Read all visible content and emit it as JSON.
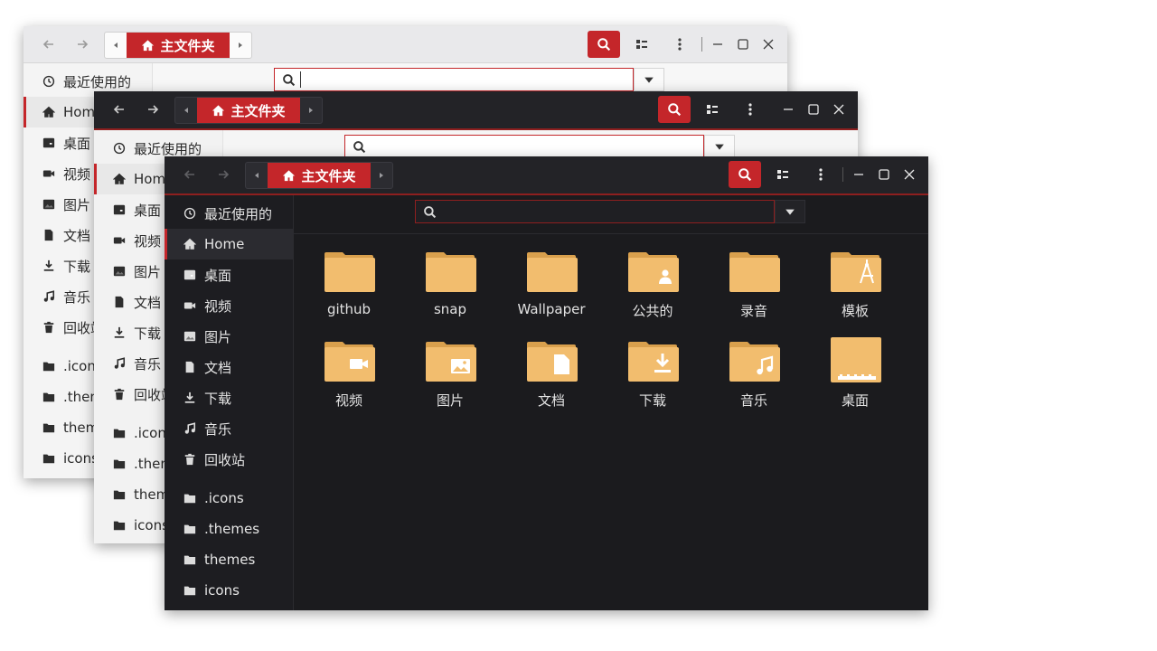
{
  "path": {
    "crumb": "主文件夹"
  },
  "sidebar_light": [
    {
      "label": "最近使用的",
      "icon": "clock-icon"
    },
    {
      "label": "Home",
      "icon": "home-icon",
      "active": true
    },
    {
      "label": "桌面",
      "icon": "desktop-icon"
    },
    {
      "label": "视频",
      "icon": "video-icon"
    },
    {
      "label": "图片",
      "icon": "image-icon"
    },
    {
      "label": "文档",
      "icon": "document-icon"
    },
    {
      "label": "下载",
      "icon": "download-icon"
    },
    {
      "label": "音乐",
      "icon": "music-icon"
    },
    {
      "label": "回收站",
      "icon": "trash-icon"
    },
    {
      "label": ".icons",
      "icon": "folder-icon"
    },
    {
      "label": ".themes",
      "icon": "folder-icon"
    },
    {
      "label": "themes",
      "icon": "folder-icon"
    },
    {
      "label": "icons",
      "icon": "folder-icon"
    }
  ],
  "sidebar_dark": [
    {
      "label": "最近使用的",
      "icon": "clock-icon"
    },
    {
      "label": "Home",
      "icon": "home-icon",
      "active": true
    },
    {
      "label": "桌面",
      "icon": "desktop-icon"
    },
    {
      "label": "视频",
      "icon": "video-icon"
    },
    {
      "label": "图片",
      "icon": "image-icon"
    },
    {
      "label": "文档",
      "icon": "document-icon"
    },
    {
      "label": "下载",
      "icon": "download-icon"
    },
    {
      "label": "音乐",
      "icon": "music-icon"
    },
    {
      "label": "回收站",
      "icon": "trash-icon"
    },
    {
      "label": ".icons",
      "icon": "folder-icon"
    },
    {
      "label": ".themes",
      "icon": "folder-icon"
    },
    {
      "label": "themes",
      "icon": "folder-icon"
    },
    {
      "label": "icons",
      "icon": "folder-icon"
    }
  ],
  "files": [
    {
      "label": "github",
      "icon": "folder-icon"
    },
    {
      "label": "snap",
      "icon": "folder-icon"
    },
    {
      "label": "Wallpaper",
      "icon": "folder-icon"
    },
    {
      "label": "公共的",
      "icon": "folder-public-icon"
    },
    {
      "label": "录音",
      "icon": "folder-icon"
    },
    {
      "label": "模板",
      "icon": "folder-templates-icon"
    },
    {
      "label": "视频",
      "icon": "folder-video-icon"
    },
    {
      "label": "图片",
      "icon": "folder-pictures-icon"
    },
    {
      "label": "文档",
      "icon": "folder-documents-icon"
    },
    {
      "label": "下载",
      "icon": "folder-download-icon"
    },
    {
      "label": "音乐",
      "icon": "folder-music-icon"
    },
    {
      "label": "桌面",
      "icon": "folder-desktop-icon"
    }
  ],
  "colors": {
    "accent": "#c4262a",
    "folder": "#f2bd6e",
    "folder_tab": "#e0a552",
    "dark_bg": "#1b1b1e"
  }
}
